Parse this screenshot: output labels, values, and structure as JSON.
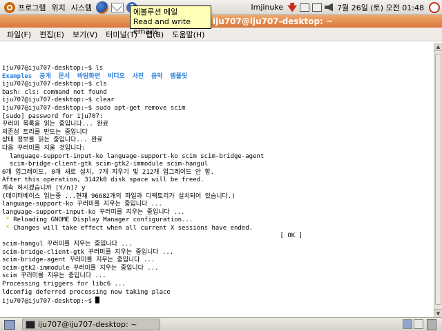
{
  "top_panel": {
    "menus": [
      "프로그램",
      "위치",
      "시스템"
    ],
    "user": "Imjinuke",
    "clock": "7월 26일 (토) 오전 01:48"
  },
  "tooltip": {
    "line1": "에볼루션 메일",
    "line2": "Read and write emails"
  },
  "window": {
    "title": "iju707@iju707-desktop: ~",
    "menu": [
      "파일(F)",
      "편집(E)",
      "보기(V)",
      "터미널(T)",
      "탭(B)",
      "도움말(H)"
    ]
  },
  "terminal": {
    "lines": [
      "iju707@iju707-desktop:~$ ls",
      "Examples  공개  문서  바탕화면  비디오  사진  음악  템플릿",
      "iju707@iju707-desktop:~$ cls",
      "bash: cls: command not found",
      "iju707@iju707-desktop:~$ clear",
      "iju707@iju707-desktop:~$ sudo apt-get remove scim",
      "[sudo] password for iju707:",
      "꾸러미 목록을 읽는 중입니다... 완료",
      "의존성 트리를 만드는 중입니다",
      "상태 정보를 읽는 중입니다... 완료",
      "다음 꾸러미를 지울 것입니다:",
      "  language-support-input-ko language-support-ko scim scim-bridge-agent",
      "  scim-bridge-client-gtk scim-gtk2-immodule scim-hangul",
      "0개 업그레이드, 0개 새로 설치, 7개 지우기 및 212개 업그레이드 안 함.",
      "After this operation, 3142kB disk space will be freed.",
      "계속 하시겠습니까 [Y/n]? y",
      "(데이터베이스 읽는중 ...현재 96682개의 파일과 디렉토리가 설치되어 있습니다.)",
      "language-support-ko 꾸러미를 지우는 중입니다 ...",
      "language-support-input-ko 꾸러미를 지우는 중입니다 ...",
      "",
      "",
      "",
      "scim-hangul 꾸러미를 지우는 중입니다 ...",
      "scim-bridge-client-gtk 꾸러미를 지우는 중입니다 ...",
      "scim-bridge-agent 꾸러미를 지우는 중입니다 ...",
      "scim-gtk2-immodule 꾸러미를 지우는 중입니다 ...",
      "scim 꾸러미를 지우는 중입니다 ...",
      "Processing triggers for libc6 ...",
      "ldconfig deferred processing now taking place",
      "iju707@iju707-desktop:~$ "
    ],
    "bullet1": "Reloading GNOME Display Manager configuration...",
    "bullet2": "Changes will take effect when all current X sessions have ended.",
    "ok": "[ OK ]"
  },
  "taskbar": {
    "task_label": "iju707@iju707-desktop: ~"
  }
}
